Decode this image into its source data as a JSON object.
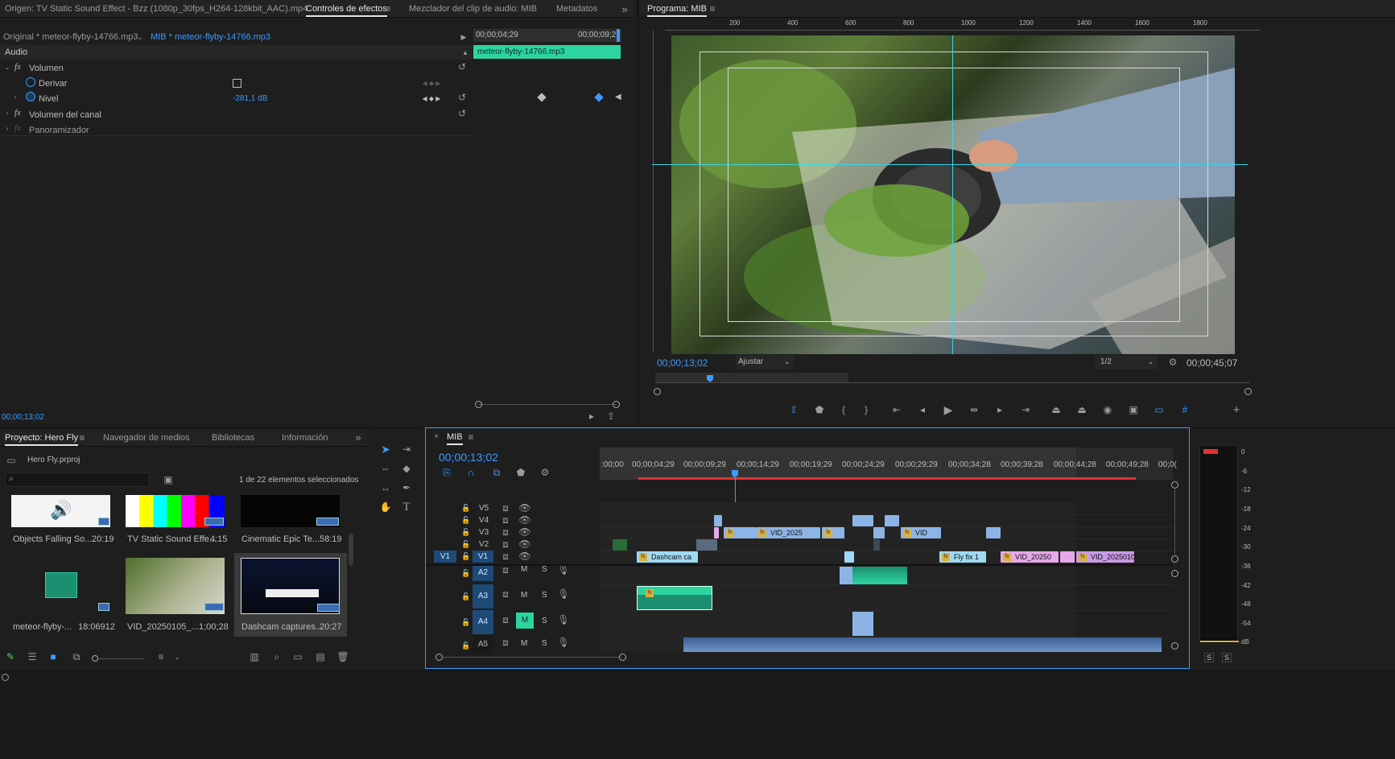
{
  "source_panel": {
    "tabs": [
      "Origen: TV Static Sound Effect - Bzz (1080p_30fps_H264-128kbit_AAC).mp4",
      "Controles de efectos",
      "Mezclador del clip de audio: MIB",
      "Metadatos"
    ],
    "clip_original": "Original * meteor-flyby-14766.mp3",
    "clip_sequence": "MIB * meteor-flyby-14766.mp3",
    "section": "Audio",
    "effects": [
      {
        "label": "Volumen"
      },
      {
        "label": "Derivar"
      },
      {
        "label": "Nivel",
        "value": "-281,1 dB"
      },
      {
        "label": "Volumen del canal"
      },
      {
        "label": "Panoramizador"
      }
    ],
    "mini_timeline": {
      "start": "00;00;04;29",
      "end": "00;00;09;2",
      "clip": "meteor-flyby-14766.mp3"
    },
    "timecode": "00;00;13;02"
  },
  "program_monitor": {
    "title": "Programa: MIB",
    "ruler_ticks": [
      "200",
      "400",
      "600",
      "800",
      "1000",
      "1200",
      "1400",
      "1600",
      "1800"
    ],
    "current_time": "00;00;13;02",
    "fit": "Ajustar",
    "resolution": "1/2",
    "duration": "00;00;45;07"
  },
  "project_panel": {
    "tabs": [
      "Proyecto: Hero Fly",
      "Navegador de medios",
      "Bibliotecas",
      "Información"
    ],
    "project_file": "Hero Fly.prproj",
    "selection_count": "1 de 22 elementos seleccionados",
    "items": [
      {
        "name": "Objects Falling So...",
        "duration": "20:19"
      },
      {
        "name": "TV Static Sound Effe...",
        "duration": "4:15"
      },
      {
        "name": "Cinematic Epic Te...",
        "duration": "58:19"
      },
      {
        "name": "meteor-flyby-...",
        "duration": "18:06912"
      },
      {
        "name": "VID_20250105_...",
        "duration": "1;00;28"
      },
      {
        "name": "Dashcam captures...",
        "duration": "20:27"
      }
    ]
  },
  "timeline": {
    "sequence": "MIB",
    "timecode": "00;00;13;02",
    "ruler": [
      ":00;00",
      "00;00;04;29",
      "00;00;09;29",
      "00;00;14;29",
      "00;00;19;29",
      "00;00;24;29",
      "00;00;29;29",
      "00;00;34;28",
      "00;00;39;28",
      "00;00;44;28",
      "00;00;49;28",
      "00;0("
    ],
    "video_tracks": [
      "V5",
      "V4",
      "V3",
      "V2",
      "V1"
    ],
    "audio_tracks": [
      "A2",
      "A3",
      "A4",
      "A5"
    ],
    "source_patch": "V1",
    "mute_label": "M",
    "solo_label": "S",
    "clips": {
      "v3_a": "VID_2025",
      "v3_b": "VID",
      "v1_a": "Dashcam ca",
      "v1_b": "Fly fix 1",
      "v1_c": "VID_20250",
      "v1_d": "VID_2025010"
    }
  },
  "meter": {
    "scale": [
      "0",
      "-6",
      "-12",
      "-18",
      "-24",
      "-30",
      "-36",
      "-42",
      "-48",
      "-54",
      "dB"
    ],
    "solo": [
      "S",
      "S"
    ]
  },
  "colors": {
    "accent_blue": "#3c9aff",
    "audio_clip": "#2dd4a0",
    "video_clip": "#8db4e6",
    "pink_clip": "#e7a8e9",
    "playhead_red": "#e03434"
  }
}
